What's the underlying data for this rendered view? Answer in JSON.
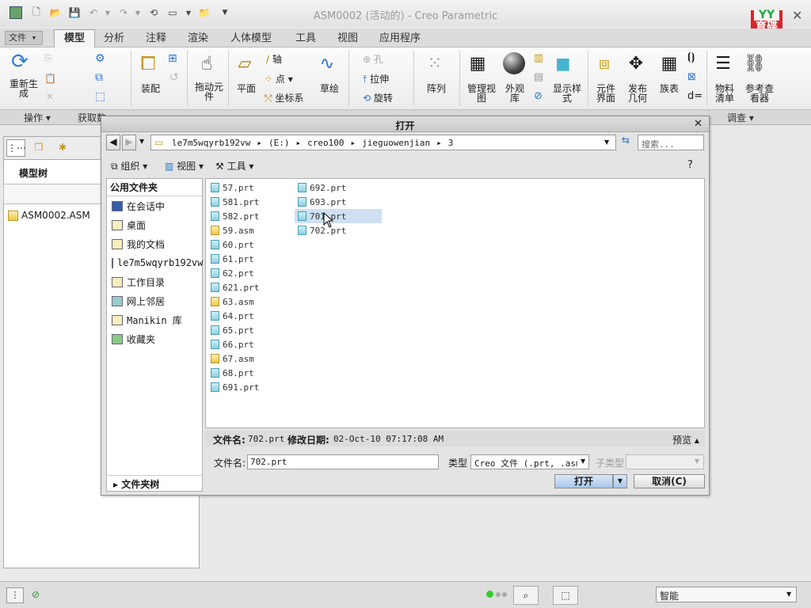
{
  "window": {
    "title": "ASM0002 (活动的) - Creo Parametric"
  },
  "logo": {
    "top": "YY",
    "text": "育碟软件"
  },
  "ribbon": {
    "tabs": [
      {
        "label": "文件 ▾"
      },
      {
        "label": "模型"
      },
      {
        "label": "分析"
      },
      {
        "label": "注释"
      },
      {
        "label": "渲染"
      },
      {
        "label": "人体模型"
      },
      {
        "label": "工具"
      },
      {
        "label": "视图"
      },
      {
        "label": "应用程序"
      }
    ],
    "buttons": {
      "regenerate": "重新生成",
      "assemble": "装配",
      "drag": "拖动元件",
      "plane": "平面",
      "axis": "轴",
      "point": "点",
      "csys": "坐标系",
      "sketch": "草绘",
      "hole": "孔",
      "extrude": "拉伸",
      "revolve": "旋转",
      "pattern": "阵列",
      "manage_views": "管理视图",
      "appearance": "外观库",
      "display_style": "显示样式",
      "component_interface": "元件界面",
      "publish_geometry": "发布几何",
      "family_table": "族表",
      "bom": "物料清单",
      "reference_viewer": "参考查看器",
      "d_eq": "d="
    },
    "groups": [
      "操作 ▾",
      "获取数",
      "调查 ▾"
    ]
  },
  "left_panel": {
    "title": "模型树",
    "tree_root": "ASM0002.ASM"
  },
  "dialog": {
    "title": "打开",
    "address": [
      "le7m5wqyrb192vw",
      "(E:)",
      "creo100",
      "jieguowenjian",
      "3"
    ],
    "search_placeholder": "搜索...",
    "toolbar": {
      "organize": "组织",
      "view": "视图",
      "tools": "工具"
    },
    "places_header": "公用文件夹",
    "places": [
      {
        "label": "在会话中"
      },
      {
        "label": "桌面"
      },
      {
        "label": "我的文档"
      },
      {
        "label": "le7m5wqyrb192vw"
      },
      {
        "label": "工作目录"
      },
      {
        "label": "网上邻居"
      },
      {
        "label": "Manikin 库"
      },
      {
        "label": "收藏夹"
      }
    ],
    "folder_tree": "文件夹树",
    "files_col1": [
      {
        "name": "57.prt",
        "kind": "prt"
      },
      {
        "name": "581.prt",
        "kind": "prt"
      },
      {
        "name": "582.prt",
        "kind": "prt"
      },
      {
        "name": "59.asm",
        "kind": "asm"
      },
      {
        "name": "60.prt",
        "kind": "prt"
      },
      {
        "name": "61.prt",
        "kind": "prt"
      },
      {
        "name": "62.prt",
        "kind": "prt"
      },
      {
        "name": "621.prt",
        "kind": "prt"
      },
      {
        "name": "63.asm",
        "kind": "asm"
      },
      {
        "name": "64.prt",
        "kind": "prt"
      },
      {
        "name": "65.prt",
        "kind": "prt"
      },
      {
        "name": "66.prt",
        "kind": "prt"
      },
      {
        "name": "67.asm",
        "kind": "asm"
      },
      {
        "name": "68.prt",
        "kind": "prt"
      },
      {
        "name": "691.prt",
        "kind": "prt"
      }
    ],
    "files_col2": [
      {
        "name": "692.prt",
        "kind": "prt"
      },
      {
        "name": "693.prt",
        "kind": "prt"
      },
      {
        "name": "701.prt",
        "kind": "prt",
        "selected": true
      },
      {
        "name": "702.prt",
        "kind": "prt"
      }
    ],
    "info": {
      "name_label": "文件名:",
      "name_value": "702.prt",
      "date_label": "修改日期:",
      "date_value": "02-Oct-10 07:17:08 AM",
      "preview": "预览"
    },
    "filename_label": "文件名:",
    "filename_value": "702.prt",
    "type_label": "类型",
    "type_value": "Creo 文件 (.prt, .asm,",
    "subtype_label": "子类型",
    "open_button": "打开",
    "cancel_button": "取消(C)"
  },
  "status": {
    "mode": "智能"
  }
}
